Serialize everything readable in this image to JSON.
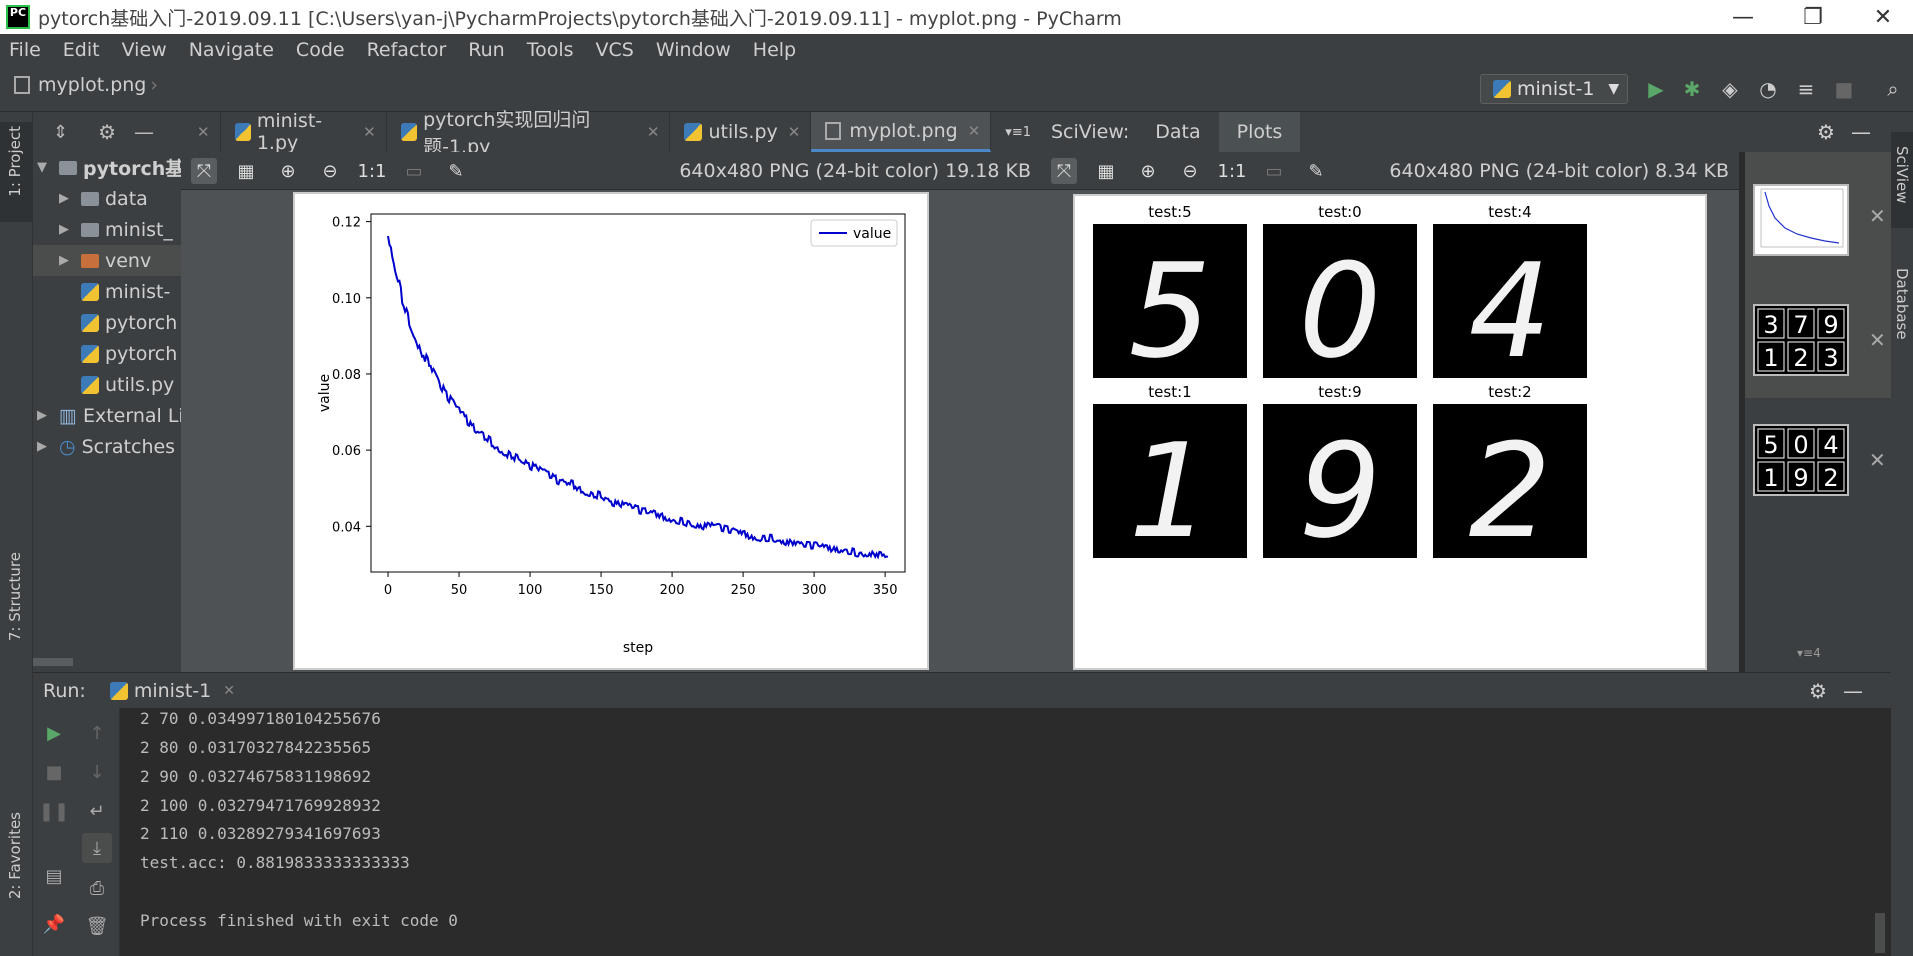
{
  "window": {
    "title": "pytorch基础入门-2019.09.11 [C:\\Users\\yan-j\\PycharmProjects\\pytorch基础入门-2019.09.11] - myplot.png - PyCharm",
    "logo": "PC"
  },
  "menu": [
    "File",
    "Edit",
    "View",
    "Navigate",
    "Code",
    "Refactor",
    "Run",
    "Tools",
    "VCS",
    "Window",
    "Help"
  ],
  "nav": {
    "file": "myplot.png",
    "run_config": "minist-1"
  },
  "side_tabs": {
    "project": "1: Project",
    "structure": "7: Structure",
    "favorites": "2: Favorites",
    "sciview": "SciView",
    "database": "Database"
  },
  "project_tree": [
    {
      "label": "pytorch基",
      "kind": "root"
    },
    {
      "label": "data",
      "kind": "folder"
    },
    {
      "label": "minist_",
      "kind": "folder"
    },
    {
      "label": "venv",
      "kind": "folder-orange"
    },
    {
      "label": "minist-",
      "kind": "py"
    },
    {
      "label": "pytorch",
      "kind": "py"
    },
    {
      "label": "pytorch",
      "kind": "py"
    },
    {
      "label": "utils.py",
      "kind": "py"
    },
    {
      "label": "External Li",
      "kind": "lib"
    },
    {
      "label": "Scratches ",
      "kind": "scratch"
    }
  ],
  "tabs": [
    {
      "label": "minist-1.py",
      "active": false
    },
    {
      "label": "pytorch实现回归问题-1.py",
      "active": false
    },
    {
      "label": "utils.py",
      "active": false
    },
    {
      "label": "myplot.png",
      "active": true
    }
  ],
  "tabs_overflow": "1",
  "image_info_1": "640x480 PNG (24-bit color) 19.18 KB",
  "image_info_2": "640x480 PNG (24-bit color) 8.34 KB",
  "toolbar_ratio": "1:1",
  "sciview": {
    "title": "SciView:",
    "tabs": [
      "Data",
      "Plots"
    ],
    "active_tab": "Plots",
    "plot_count": "4"
  },
  "chart_data": {
    "type": "line",
    "legend": "value",
    "xlabel": "step",
    "ylabel": "value",
    "xlim": [
      -12,
      364
    ],
    "ylim": [
      0.028,
      0.122
    ],
    "xticks": [
      0,
      50,
      100,
      150,
      200,
      250,
      300,
      350
    ],
    "yticks": [
      0.04,
      0.06,
      0.08,
      0.1,
      0.12
    ],
    "ytick_labels": [
      "0.04",
      "0.06",
      "0.08",
      "0.10",
      "0.12"
    ],
    "color": "#0000cc",
    "x": [
      0,
      5,
      10,
      15,
      20,
      25,
      30,
      40,
      50,
      60,
      70,
      80,
      90,
      100,
      110,
      120,
      130,
      140,
      150,
      160,
      170,
      180,
      190,
      200,
      210,
      220,
      230,
      240,
      250,
      260,
      270,
      280,
      290,
      300,
      310,
      320,
      330,
      340,
      350,
      352
    ],
    "y": [
      0.116,
      0.108,
      0.1,
      0.094,
      0.089,
      0.085,
      0.082,
      0.075,
      0.07,
      0.066,
      0.063,
      0.06,
      0.058,
      0.056,
      0.054,
      0.052,
      0.051,
      0.049,
      0.048,
      0.046,
      0.045,
      0.044,
      0.043,
      0.042,
      0.041,
      0.04,
      0.04,
      0.039,
      0.038,
      0.037,
      0.037,
      0.036,
      0.035,
      0.035,
      0.034,
      0.034,
      0.033,
      0.033,
      0.032,
      0.032
    ]
  },
  "digits": [
    {
      "title": "test:5",
      "digit": "5"
    },
    {
      "title": "test:0",
      "digit": "0"
    },
    {
      "title": "test:4",
      "digit": "4"
    },
    {
      "title": "test:1",
      "digit": "1"
    },
    {
      "title": "test:9",
      "digit": "9"
    },
    {
      "title": "test:2",
      "digit": "2"
    }
  ],
  "thumbnails": [
    {
      "kind": "line-plot"
    },
    {
      "kind": "digits",
      "digits": [
        "3",
        "7",
        "9",
        "1",
        "2",
        "3"
      ]
    },
    {
      "kind": "digits",
      "digits": [
        "5",
        "0",
        "4",
        "1",
        "9",
        "2"
      ]
    }
  ],
  "run": {
    "label": "Run:",
    "config": "minist-1"
  },
  "console": [
    "2 70 0.034997180104255676",
    "2 80 0.03170327842235565",
    "2 90 0.03274675831198692",
    "2 100 0.03279471769928932",
    "2 110 0.03289279341697693",
    "test.acc: 0.8819833333333333",
    "",
    "Process finished with exit code 0"
  ],
  "colors": {
    "accent": "#4a88c7",
    "run_green": "#59a869",
    "plot_line": "#0000cc"
  }
}
